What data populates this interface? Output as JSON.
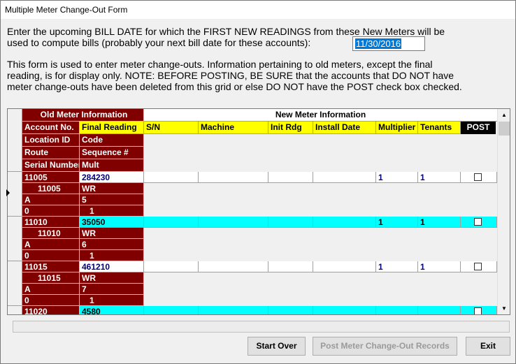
{
  "window": {
    "title": "Multiple Meter Change-Out Form"
  },
  "instructions": {
    "line1": "Enter the upcoming BILL DATE for which the FIRST NEW READINGS from these New Meters will be",
    "line2": "used to compute bills (probably your next bill date for these accounts):",
    "bill_date": "11/30/2016",
    "note_line1": "This form is used to enter meter change-outs.  Information pertaining to old meters, except the final",
    "note_line2": "reading, is for display only.   NOTE: BEFORE POSTING, BE SURE that the accounts that DO NOT have",
    "note_line3": "meter change-outs have been deleted from this grid or else DO NOT have the POST check box checked."
  },
  "grid": {
    "old_header": "Old Meter Information",
    "new_header": "New Meter Information",
    "old_cols": {
      "account_no": "Account No.",
      "final_reading": "Final Reading",
      "location_id": "Location ID",
      "code": "Code",
      "route": "Route",
      "sequence": "Sequence #",
      "serial_number": "Serial Number",
      "mult": "Mult"
    },
    "new_cols": {
      "sn": "S/N",
      "machine": "Machine",
      "init_rdg": "Init Rdg",
      "install_date": "Install Date",
      "multiplier": "Multiplier",
      "tenants": "Tenants",
      "post": "POST"
    },
    "records": [
      {
        "account": "11005",
        "final_reading": "284230",
        "location": "11005",
        "code": "WR",
        "route": "A",
        "sequence": "5",
        "serial": "0",
        "mult": "1",
        "multiplier": "1",
        "tenants": "1",
        "post": false
      },
      {
        "account": "11010",
        "final_reading": "35050",
        "location": "11010",
        "code": "WR",
        "route": "A",
        "sequence": "6",
        "serial": "0",
        "mult": "1",
        "multiplier": "1",
        "tenants": "1",
        "post": false
      },
      {
        "account": "11015",
        "final_reading": "461210",
        "location": "11015",
        "code": "WR",
        "route": "A",
        "sequence": "7",
        "serial": "0",
        "mult": "1",
        "multiplier": "1",
        "tenants": "1",
        "post": false
      },
      {
        "account": "11020",
        "final_reading": "4580"
      }
    ]
  },
  "buttons": {
    "start_over": "Start Over",
    "post_records": "Post Meter Change-Out Records",
    "exit": "Exit"
  },
  "colors": {
    "old_info": "#800000",
    "header_yellow": "#ffff00",
    "alt_row": "#00ffff",
    "selection": "#0078d7"
  }
}
